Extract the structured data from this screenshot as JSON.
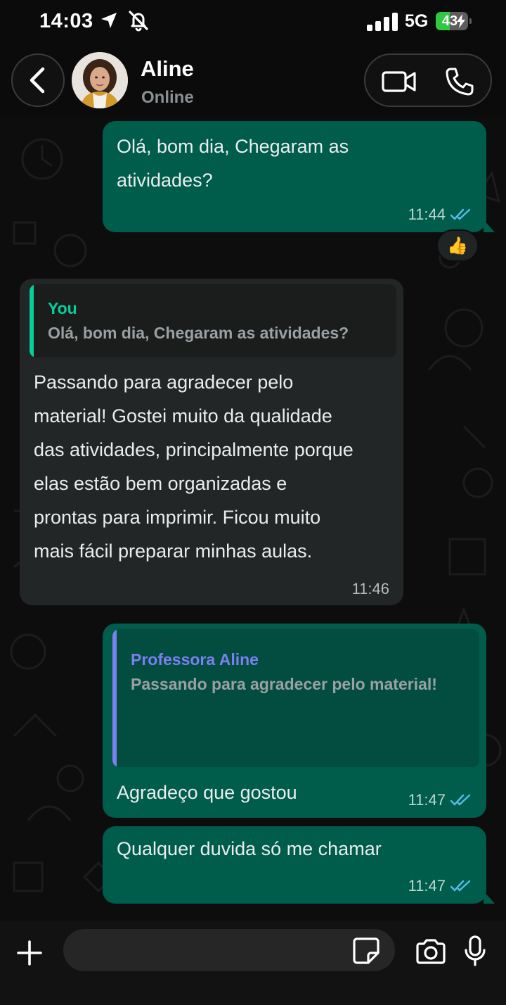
{
  "status_bar": {
    "time": "14:03",
    "network": "5G",
    "battery": "43",
    "battery_level_percent": 43,
    "icons": [
      "location-arrow-icon",
      "bell-off-icon",
      "signal-bars-icon",
      "battery-charging-icon"
    ]
  },
  "header": {
    "contact_name": "Aline",
    "contact_status": "Online",
    "icons": [
      "back-chevron-icon",
      "video-call-icon",
      "voice-call-icon"
    ]
  },
  "messages": [
    {
      "direction": "outgoing",
      "text": "Olá, bom dia, Chegaram as atividades?",
      "lines": [
        "Olá, bom dia, Chegaram as",
        "atividades?"
      ],
      "time": "11:44",
      "status": "read",
      "reaction": "👍"
    },
    {
      "direction": "incoming",
      "quote": {
        "author": "You",
        "text": "Olá, bom dia, Chegaram as atividades?"
      },
      "lines": [
        "Passando para agradecer pelo",
        "material! Gostei muito da qualidade",
        "das atividades, principalmente porque",
        "elas estão bem organizadas e",
        "prontas para imprimir. Ficou muito",
        "mais fácil preparar minhas aulas."
      ],
      "time": "11:46"
    },
    {
      "direction": "outgoing",
      "quote": {
        "author": "Professora Aline",
        "text": "Passando para agradecer pelo material!"
      },
      "text": "Agradeço que gostou",
      "time": "11:47",
      "status": "read"
    },
    {
      "direction": "outgoing",
      "text": "Qualquer duvida só me chamar",
      "time": "11:47",
      "status": "read"
    }
  ],
  "input_bar": {
    "placeholder": "",
    "icons": [
      "plus-icon",
      "sticker-icon",
      "camera-icon",
      "microphone-icon"
    ]
  },
  "colors": {
    "outgoing_bubble": "#005c4b",
    "incoming_bubble": "#232626",
    "read_ticks": "#53bdeb",
    "quote_you": "#06cf9c",
    "quote_aline": "#7b7ff0",
    "battery_fill": "#30c840"
  }
}
